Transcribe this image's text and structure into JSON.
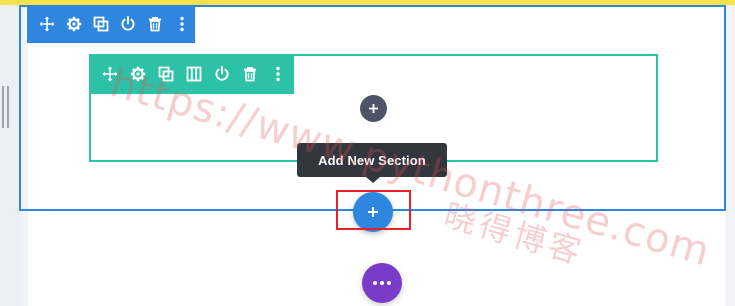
{
  "section_toolbar": {
    "buttons": [
      {
        "icon": "move-icon",
        "label": "Move Section"
      },
      {
        "icon": "gear-icon",
        "label": "Section Settings"
      },
      {
        "icon": "duplicate-icon",
        "label": "Duplicate Section"
      },
      {
        "icon": "power-icon",
        "label": "Disable Section"
      },
      {
        "icon": "trash-icon",
        "label": "Delete Section"
      },
      {
        "icon": "more-vertical-icon",
        "label": "More Options"
      }
    ]
  },
  "row_toolbar": {
    "buttons": [
      {
        "icon": "move-icon",
        "label": "Move Row"
      },
      {
        "icon": "gear-icon",
        "label": "Row Settings"
      },
      {
        "icon": "duplicate-icon",
        "label": "Duplicate Row"
      },
      {
        "icon": "columns-icon",
        "label": "Change Column Structure"
      },
      {
        "icon": "power-icon",
        "label": "Disable Row"
      },
      {
        "icon": "trash-icon",
        "label": "Delete Row"
      },
      {
        "icon": "more-vertical-icon",
        "label": "More Options"
      }
    ]
  },
  "tooltip": {
    "text": "Add New Section"
  },
  "watermark": {
    "url": "https://www.pythonthree.com",
    "cn": "晓得博客"
  },
  "colors": {
    "section_blue": "#2e86de",
    "row_teal": "#2dc2a7",
    "module_dark": "#4d5468",
    "more_purple": "#7b3bc9",
    "highlight_red": "#e8202a",
    "top_accent_yellow": "#f7e24b"
  }
}
